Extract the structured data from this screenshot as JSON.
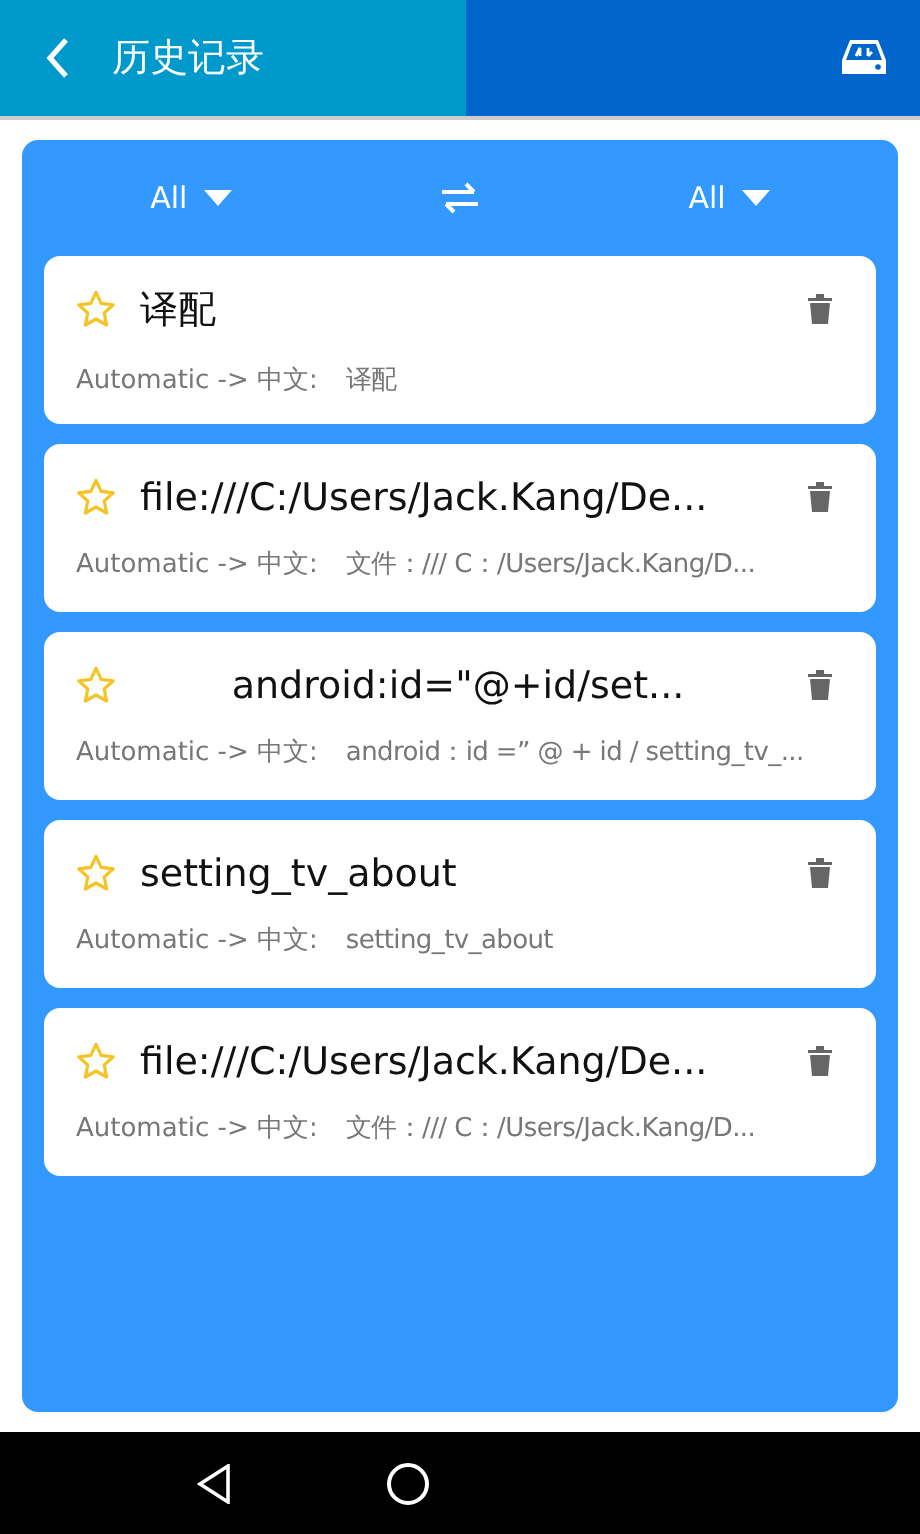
{
  "header": {
    "title": "历史记录"
  },
  "language_bar": {
    "source": "All",
    "target": "All"
  },
  "history": [
    {
      "title": "译配",
      "kind": "plain",
      "starred": false,
      "detail": "Automatic -> 中文:",
      "translation": "译配"
    },
    {
      "title": "file:///C:/Users/Jack.Kang/De...",
      "kind": "plain",
      "starred": false,
      "detail": "Automatic -> 中文:",
      "translation": "文件：/// C：/Users/Jack.Kang/D..."
    },
    {
      "title": "android:id=\"@+id/set...",
      "kind": "centered",
      "starred": false,
      "detail": "Automatic -> 中文:",
      "translation": "android：id =” @ + id / setting_tv_..."
    },
    {
      "title": "setting_tv_about",
      "kind": "plain",
      "starred": false,
      "detail": "Automatic -> 中文:",
      "translation": "setting_tv_about"
    },
    {
      "title": "file:///C:/Users/Jack.Kang/De...",
      "kind": "plain",
      "starred": false,
      "detail": "Automatic -> 中文:",
      "translation": "文件：/// C：/Users/Jack.Kang/D..."
    }
  ]
}
